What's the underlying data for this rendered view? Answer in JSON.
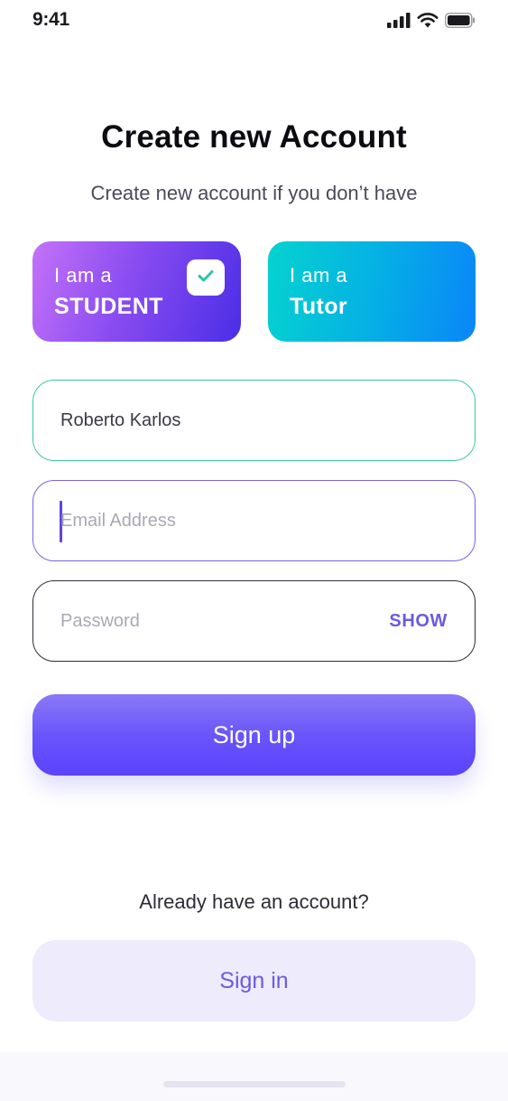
{
  "status_bar": {
    "time": "9:41",
    "icons": [
      "signal-icon",
      "wifi-icon",
      "battery-icon"
    ]
  },
  "header": {
    "title": "Create new Account",
    "subtitle": "Create new account if you don’t have"
  },
  "roles": {
    "student": {
      "line1": "I am a",
      "line2": "STUDENT",
      "selected": true,
      "icon": "check-icon"
    },
    "tutor": {
      "line1": "I am a",
      "line2": "Tutor",
      "selected": false
    }
  },
  "form": {
    "name": {
      "value": "Roberto Karlos"
    },
    "email": {
      "placeholder": "Email Address",
      "focused": true
    },
    "password": {
      "placeholder": "Password",
      "toggle_label": "SHOW"
    }
  },
  "actions": {
    "signup_label": "Sign up",
    "already_text": "Already have an account?",
    "signin_label": "Sign in"
  },
  "colors": {
    "accent": "#5b42fc",
    "name_border": "#3cc7a4",
    "email_border": "#7a62e0",
    "signin_bg": "#eeebfd"
  }
}
